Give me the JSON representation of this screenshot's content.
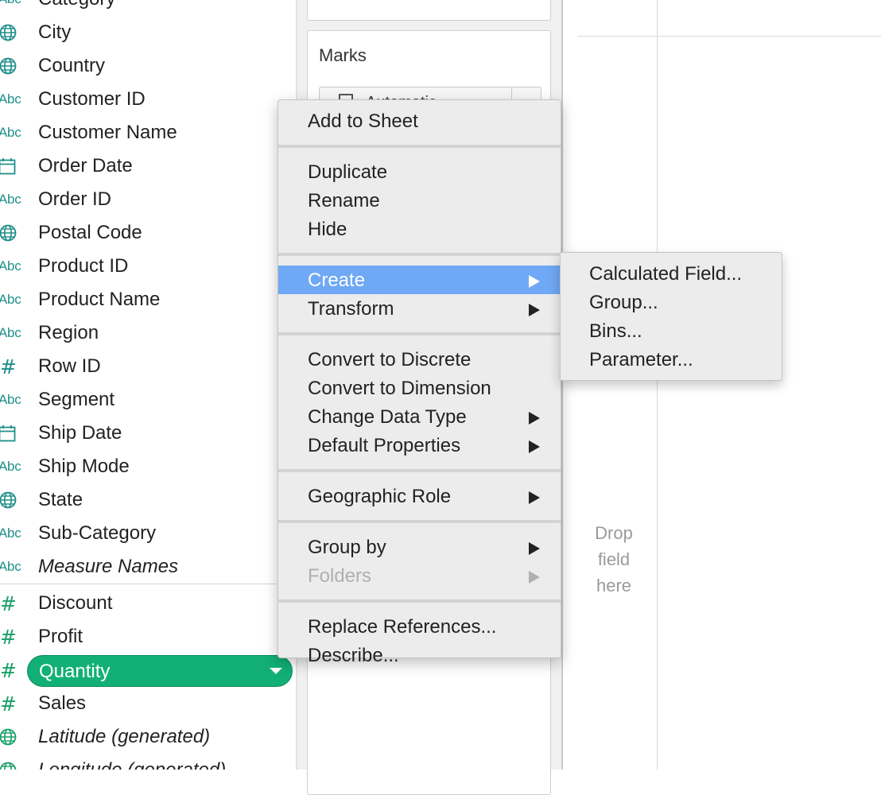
{
  "data_pane": {
    "fields": [
      {
        "label": "Category",
        "icon": "abc-string-icon",
        "type": "dimension"
      },
      {
        "label": "City",
        "icon": "globe-icon",
        "type": "dimension"
      },
      {
        "label": "Country",
        "icon": "globe-icon",
        "type": "dimension"
      },
      {
        "label": "Customer ID",
        "icon": "abc-string-icon",
        "type": "dimension"
      },
      {
        "label": "Customer Name",
        "icon": "abc-string-icon",
        "type": "dimension"
      },
      {
        "label": "Order Date",
        "icon": "calendar-icon",
        "type": "dimension"
      },
      {
        "label": "Order ID",
        "icon": "abc-string-icon",
        "type": "dimension"
      },
      {
        "label": "Postal Code",
        "icon": "globe-icon",
        "type": "dimension"
      },
      {
        "label": "Product ID",
        "icon": "abc-string-icon",
        "type": "dimension"
      },
      {
        "label": "Product Name",
        "icon": "abc-string-icon",
        "type": "dimension"
      },
      {
        "label": "Region",
        "icon": "abc-string-icon",
        "type": "dimension"
      },
      {
        "label": "Row ID",
        "icon": "hash-icon",
        "type": "dimension"
      },
      {
        "label": "Segment",
        "icon": "abc-string-icon",
        "type": "dimension"
      },
      {
        "label": "Ship Date",
        "icon": "calendar-icon",
        "type": "dimension"
      },
      {
        "label": "Ship Mode",
        "icon": "abc-string-icon",
        "type": "dimension"
      },
      {
        "label": "State",
        "icon": "globe-icon",
        "type": "dimension"
      },
      {
        "label": "Sub-Category",
        "icon": "abc-string-icon",
        "type": "dimension"
      },
      {
        "label": "Measure Names",
        "icon": "abc-string-icon",
        "type": "dimension",
        "italic": true
      },
      {
        "label": "Discount",
        "icon": "hash-icon",
        "type": "measure"
      },
      {
        "label": "Profit",
        "icon": "hash-icon",
        "type": "measure"
      },
      {
        "label": "Quantity",
        "icon": "hash-icon",
        "type": "measure",
        "selected": true
      },
      {
        "label": "Sales",
        "icon": "hash-icon",
        "type": "measure"
      },
      {
        "label": "Latitude (generated)",
        "icon": "globe-icon",
        "type": "measure",
        "italic": true
      },
      {
        "label": "Longitude (generated)",
        "icon": "globe-icon",
        "type": "measure",
        "italic": true
      }
    ],
    "icon_text": {
      "abc": "Abc",
      "hash": "#"
    },
    "colors": {
      "dimension_icon": "#1f8f8a",
      "measure_icon": "#1aa06a",
      "selected_pill": "#12b077"
    }
  },
  "marks": {
    "title": "Marks",
    "mark_type": "Automatic"
  },
  "view": {
    "drop_hint": [
      "Drop",
      "field",
      "here"
    ]
  },
  "context_menu": {
    "groups": [
      [
        {
          "label": "Add to Sheet"
        }
      ],
      [
        {
          "label": "Duplicate"
        },
        {
          "label": "Rename"
        },
        {
          "label": "Hide"
        }
      ],
      [
        {
          "label": "Create",
          "submenu": true,
          "highlighted": true
        },
        {
          "label": "Transform",
          "submenu": true
        }
      ],
      [
        {
          "label": "Convert to Discrete"
        },
        {
          "label": "Convert to Dimension"
        },
        {
          "label": "Change Data Type",
          "submenu": true
        },
        {
          "label": "Default Properties",
          "submenu": true
        }
      ],
      [
        {
          "label": "Geographic Role",
          "submenu": true
        }
      ],
      [
        {
          "label": "Group by",
          "submenu": true
        },
        {
          "label": "Folders",
          "submenu": true,
          "disabled": true
        }
      ],
      [
        {
          "label": "Replace References..."
        },
        {
          "label": "Describe..."
        }
      ]
    ],
    "highlight_color": "#6fa8f4"
  },
  "submenu": {
    "items": [
      {
        "label": "Calculated Field..."
      },
      {
        "label": "Group..."
      },
      {
        "label": "Bins..."
      },
      {
        "label": "Parameter..."
      }
    ]
  }
}
